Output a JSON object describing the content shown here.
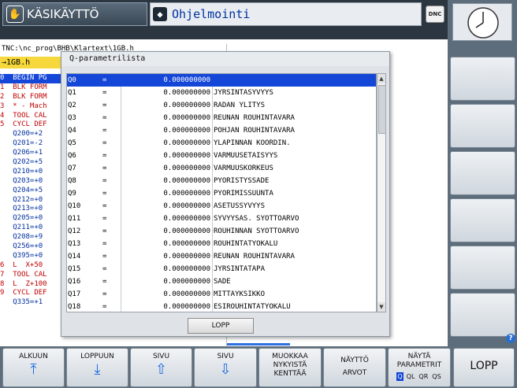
{
  "header": {
    "mode_label": "KÄSIKÄYTTÖ",
    "program_label": "Ohjelmointi",
    "dnc_label": "DNC"
  },
  "program": {
    "path": "TNC:\\nc_prog\\BHB\\Klartext\\1GB.h",
    "filename": "→1GB.h",
    "lines": [
      "0  BEGIN PG",
      "1  BLK FORM",
      "2  BLK FORM",
      "3  * - Mach",
      "4  TOOL CAL",
      "5  CYCL DEF",
      "   Q200=+2",
      "   Q201=-2",
      "   Q206=+1",
      "   Q202=+5",
      "   Q210=+0",
      "   Q203=+0",
      "   Q204=+5",
      "   Q212=+0",
      "   Q213=+0",
      "   Q205=+0",
      "   Q211=+0",
      "   Q208=+9",
      "   Q256=+0",
      "   Q395=+0",
      "6  L  X+50",
      "7  TOOL CAL",
      "8  L  Z+100",
      "9  CYCL DEF",
      "   Q335=+1"
    ]
  },
  "dialog": {
    "title": "Q-parametrilista",
    "close_label": "LOPP",
    "rows": [
      {
        "name": "Q0",
        "eq": "=",
        "value": "0.000000000",
        "desc": ""
      },
      {
        "name": "Q1",
        "eq": "=",
        "value": "0.000000000",
        "desc": "JYRSINTASYVYYS"
      },
      {
        "name": "Q2",
        "eq": "=",
        "value": "0.000000000",
        "desc": "RADAN YLITYS"
      },
      {
        "name": "Q3",
        "eq": "=",
        "value": "0.000000000",
        "desc": "REUNAN ROUHINTAVARA"
      },
      {
        "name": "Q4",
        "eq": "=",
        "value": "0.000000000",
        "desc": "POHJAN ROUHINTAVARA"
      },
      {
        "name": "Q5",
        "eq": "=",
        "value": "0.000000000",
        "desc": "YLAPINNAN KOORDIN."
      },
      {
        "name": "Q6",
        "eq": "=",
        "value": "0.000000000",
        "desc": "VARMUUSETAISYYS"
      },
      {
        "name": "Q7",
        "eq": "=",
        "value": "0.000000000",
        "desc": "VARMUUSKORKEUS"
      },
      {
        "name": "Q8",
        "eq": "=",
        "value": "0.000000000",
        "desc": "PYORISTYSSADE"
      },
      {
        "name": "Q9",
        "eq": "=",
        "value": "0.000000000",
        "desc": "PYORIMISSUUNTA"
      },
      {
        "name": "Q10",
        "eq": "=",
        "value": "0.000000000",
        "desc": "ASETUSSYVYYS"
      },
      {
        "name": "Q11",
        "eq": "=",
        "value": "0.000000000",
        "desc": "SYVYYSAS. SYOTTOARVO"
      },
      {
        "name": "Q12",
        "eq": "=",
        "value": "0.000000000",
        "desc": "ROUHINNAN SYOTTOARVO"
      },
      {
        "name": "Q13",
        "eq": "=",
        "value": "0.000000000",
        "desc": "ROUHINTATYOKALU"
      },
      {
        "name": "Q14",
        "eq": "=",
        "value": "0.000000000",
        "desc": "REUNAN ROUHINTAVARA"
      },
      {
        "name": "Q15",
        "eq": "=",
        "value": "0.000000000",
        "desc": "JYRSINTATAPA"
      },
      {
        "name": "Q16",
        "eq": "=",
        "value": "0.000000000",
        "desc": "SADE"
      },
      {
        "name": "Q17",
        "eq": "=",
        "value": "0.000000000",
        "desc": "MITTAYKSIKKO"
      },
      {
        "name": "Q18",
        "eq": "=",
        "value": "0.000000000",
        "desc": "ESIROUHINTATYOKALU"
      }
    ]
  },
  "softkeys": {
    "alkuun": "ALKUUN",
    "loppuun": "LOPPUUN",
    "sivu_up": "SIVU",
    "sivu_down": "SIVU",
    "muokkaa_1": "MUOKKAA",
    "muokkaa_2": "NYKYISTÄ",
    "muokkaa_3": "KENTTÄÄ",
    "nayto_1": "NÄYTTÖ",
    "nayto_2": "ARVOT",
    "nayta_1": "NÄYTÄ",
    "nayta_2": "PARAMETRIT",
    "q_labels": [
      "Q",
      "QL",
      "QR",
      "QS"
    ],
    "lopp": "LOPP"
  },
  "colors": {
    "selection": "#1446d8",
    "filename_bg": "#f6d83c",
    "arrow": "#1a6ae0"
  }
}
